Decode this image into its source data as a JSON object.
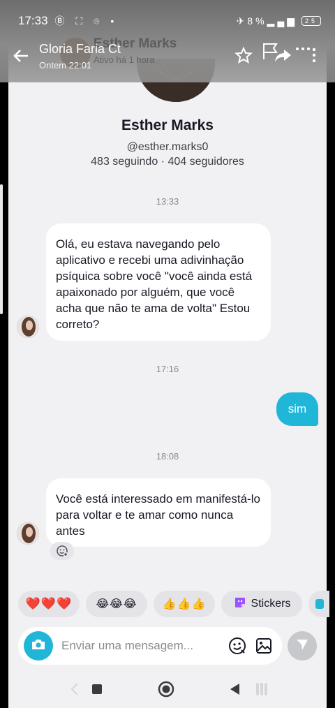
{
  "status_bar": {
    "time": "17:33",
    "battery": "8%",
    "battery_box": "25"
  },
  "overlay": {
    "title": "Gloria Faria Ct",
    "subtitle": "Ontem 22:01",
    "ghost_name": "Esther Marks",
    "ghost_subtitle": "Ativo há 1 hora"
  },
  "profile": {
    "name": "Esther Marks",
    "handle": "@esther.marks0",
    "stats": "483 seguindo · 404 seguidores"
  },
  "messages": [
    {
      "type": "timestamp",
      "text": "13:33"
    },
    {
      "type": "incoming",
      "text": "Olá, eu estava navegando pelo aplicativo e recebi uma adivinhação psíquica sobre você \"você ainda está apaixonado por alguém, que você acha que não te ama de volta\" Estou correto?"
    },
    {
      "type": "timestamp",
      "text": "17:16"
    },
    {
      "type": "outgoing",
      "text": "sim"
    },
    {
      "type": "timestamp",
      "text": "18:08"
    },
    {
      "type": "incoming",
      "text": "Você está interessado em manifestá-lo para voltar e te amar como nunca antes"
    }
  ],
  "quick_reactions": {
    "hearts": "❤️❤️❤️",
    "laughs": "😂😂😂",
    "thumbs": "👍👍👍",
    "stickers_label": "Stickers"
  },
  "composer": {
    "placeholder": "Enviar uma mensagem..."
  },
  "colors": {
    "accent": "#20b6d8",
    "background": "#f1f1f3",
    "bubble_in": "#ffffff",
    "heart": "#e02b3d"
  },
  "icons": [
    "back-arrow-icon",
    "star-icon",
    "flag-icon",
    "share-icon",
    "more-icon",
    "camera-icon",
    "emoji-icon",
    "image-icon",
    "send-icon",
    "reaction-add-icon",
    "sticker-icon"
  ]
}
